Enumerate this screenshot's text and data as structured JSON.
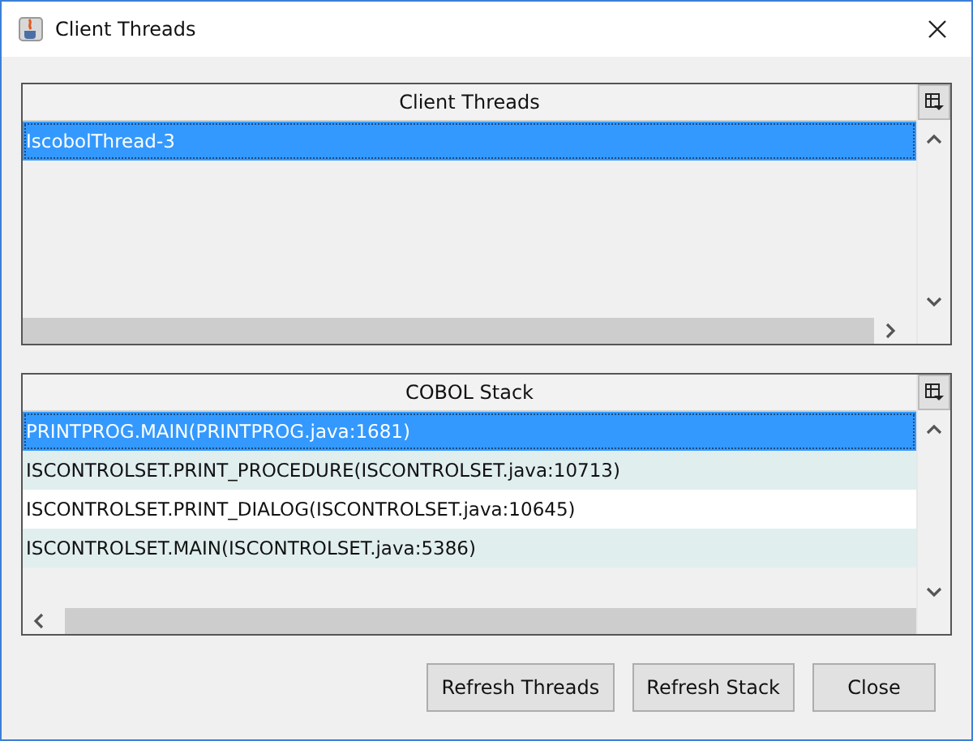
{
  "window": {
    "title": "Client Threads"
  },
  "threads_table": {
    "header": "Client Threads",
    "rows": [
      {
        "text": "IscobolThread-3",
        "selected": true
      }
    ]
  },
  "stack_table": {
    "header": "COBOL Stack",
    "rows": [
      {
        "text": "PRINTPROG.MAIN(PRINTPROG.java:1681)",
        "selected": true
      },
      {
        "text": "ISCONTROLSET.PRINT_PROCEDURE(ISCONTROLSET.java:10713)",
        "selected": false
      },
      {
        "text": "ISCONTROLSET.PRINT_DIALOG(ISCONTROLSET.java:10645)",
        "selected": false
      },
      {
        "text": "ISCONTROLSET.MAIN(ISCONTROLSET.java:5386)",
        "selected": false
      }
    ]
  },
  "buttons": [
    "Refresh Threads",
    "Refresh Stack",
    "Close"
  ]
}
